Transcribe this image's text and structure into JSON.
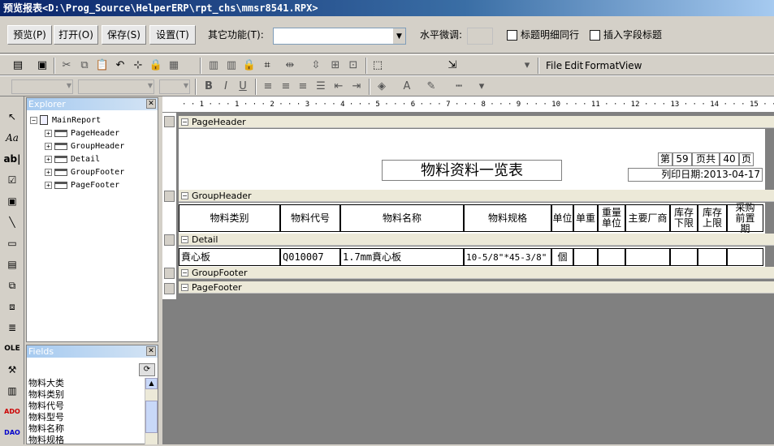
{
  "window": {
    "title": "预览报表<D:\\Prog_Source\\HelperERP\\rpt_chs\\mmsr8541.RPX>"
  },
  "mainbar": {
    "preview_btn": "预览(P)",
    "open_btn": "打开(O)",
    "save_btn": "保存(S)",
    "settings_btn": "设置(T)",
    "other_label": "其它功能(T):",
    "other_value": "",
    "hadjust_label": "水平微调:",
    "chk_same_row": "标题明细同行",
    "chk_insert_title": "插入字段标题"
  },
  "menu": {
    "file": "File",
    "edit": "Edit",
    "format": "Format",
    "view": "View"
  },
  "explorer": {
    "title": "Explorer",
    "root": "MainReport",
    "items": [
      "PageHeader",
      "GroupHeader",
      "Detail",
      "GroupFooter",
      "PageFooter"
    ]
  },
  "fields": {
    "title": "Fields",
    "items": [
      "物料大类",
      "物料类别",
      "物料代号",
      "物料型号",
      "物料名称",
      "物料规格"
    ]
  },
  "ruler": {
    "text": "· · 1 · · · 1 · · · 2 · · · 3 · · · 4 · · · 5 · · · 6 · · · 7 · · · 8 · · · 9 · · · 10 · · · 11 · · · 12 · · · 13 · · · 14 · · · 15 · · · 16 · · · 17 · · · 18 · · · 19"
  },
  "bands": {
    "pageheader": "PageHeader",
    "groupheader": "GroupHeader",
    "detail": "Detail",
    "groupfooter": "GroupFooter",
    "pagefooter": "PageFooter"
  },
  "report": {
    "title": "物料资料一览表",
    "page_prefix": "第",
    "page_no": "59",
    "page_mid": "页共",
    "page_total": "40",
    "page_suffix": "页",
    "print_date": "列印日期:2013-04-17"
  },
  "columns": [
    "物料类别",
    "物料代号",
    "物料名称",
    "物料规格",
    "单位",
    "单重",
    "重量单位",
    "主要厂商",
    "库存下限",
    "库存上限",
    "采购前置期"
  ],
  "detail_row": [
    "賁心板",
    "Q010007",
    "1.7mm賁心板",
    "10-5/8\"*45-3/8\"",
    "個",
    "",
    "",
    "",
    "",
    "",
    ""
  ],
  "colors": {
    "title_start": "#0a246a",
    "title_end": "#a6caf0",
    "band_bg": "#ece9d8",
    "canvas_bg": "#808080"
  }
}
